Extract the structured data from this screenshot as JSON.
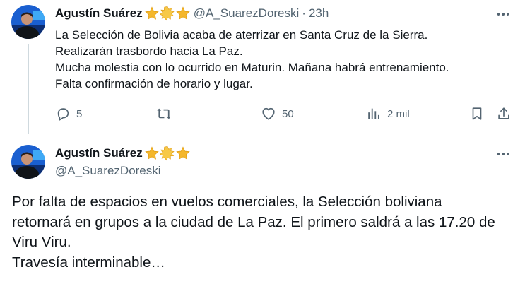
{
  "parent_tweet": {
    "author_name": "Agustín Suárez",
    "handle": "@A_SuarezDoreski",
    "separator": "·",
    "time": "23h",
    "lines": [
      "La Selección de Bolivia acaba de aterrizar en Santa Cruz de la Sierra.",
      "Realizarán trasbordo hacia La Paz.",
      "Mucha molestia con lo ocurrido en Maturin. Mañana habrá entrenamiento.",
      "Falta confirmación de horario y lugar."
    ],
    "replies": "5",
    "retweets": "",
    "likes": "50",
    "views": "2 mil"
  },
  "main_tweet": {
    "author_name": "Agustín Suárez",
    "handle": "@A_SuarezDoreski",
    "lines": [
      "Por falta de espacios en vuelos comerciales, la Selección boliviana",
      "retornará en grupos a la ciudad de La Paz. El primero saldrá a las 17.20 de",
      "Viru Viru.",
      "Travesía interminable…"
    ]
  },
  "colors": {
    "text": "#0f1419",
    "secondary": "#536471",
    "thread_line": "#cfd9de",
    "star_gold": "#f4b72c"
  },
  "icons": [
    "reply-icon",
    "retweet-icon",
    "like-icon",
    "views-icon",
    "bookmark-icon",
    "share-icon",
    "more-icon",
    "star-badge-icon"
  ]
}
